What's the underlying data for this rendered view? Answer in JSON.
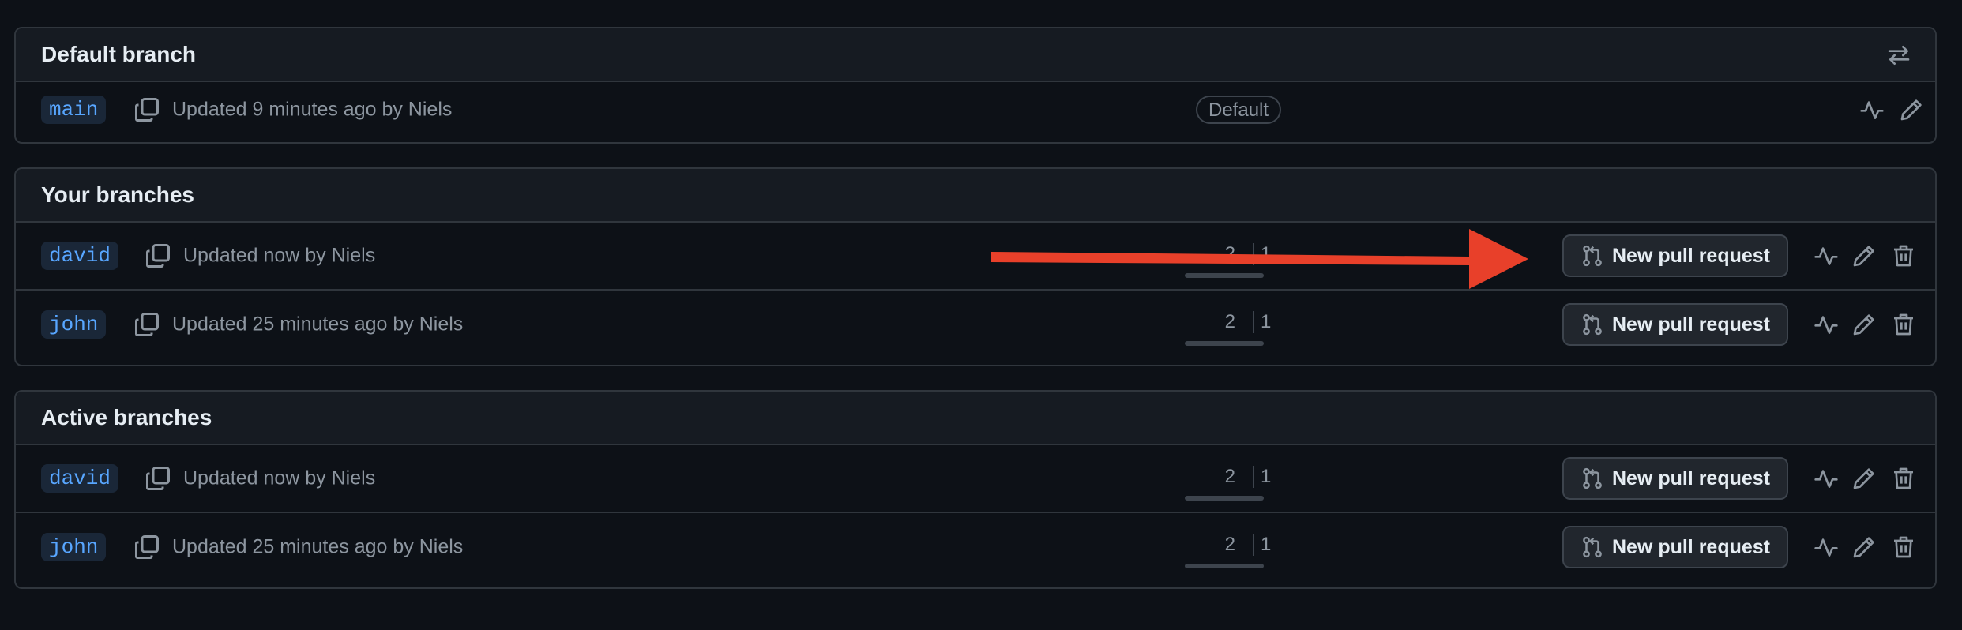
{
  "default_section": {
    "title": "Default branch",
    "rows": [
      {
        "branch": "main",
        "updated": "Updated 9 minutes ago by Niels",
        "badge": "Default"
      }
    ]
  },
  "your_section": {
    "title": "Your branches",
    "rows": [
      {
        "branch": "david",
        "updated": "Updated now by Niels",
        "behind": "2",
        "ahead": "1",
        "pr_label": "New pull request"
      },
      {
        "branch": "john",
        "updated": "Updated 25 minutes ago by Niels",
        "behind": "2",
        "ahead": "1",
        "pr_label": "New pull request"
      }
    ]
  },
  "active_section": {
    "title": "Active branches",
    "rows": [
      {
        "branch": "david",
        "updated": "Updated now by Niels",
        "behind": "2",
        "ahead": "1",
        "pr_label": "New pull request"
      },
      {
        "branch": "john",
        "updated": "Updated 25 minutes ago by Niels",
        "behind": "2",
        "ahead": "1",
        "pr_label": "New pull request"
      }
    ]
  },
  "icons": {
    "switch": "arrow-switch-icon",
    "copy": "copy-icon",
    "pull_request": "git-pull-request-icon",
    "activity": "pulse-icon",
    "edit": "pencil-icon",
    "delete": "trash-icon"
  },
  "annotation": {
    "color": "#e8402a"
  },
  "colors": {
    "background": "#0d1117",
    "link": "#58a6ff",
    "border": "#30363d",
    "muted": "#8d96a0"
  }
}
